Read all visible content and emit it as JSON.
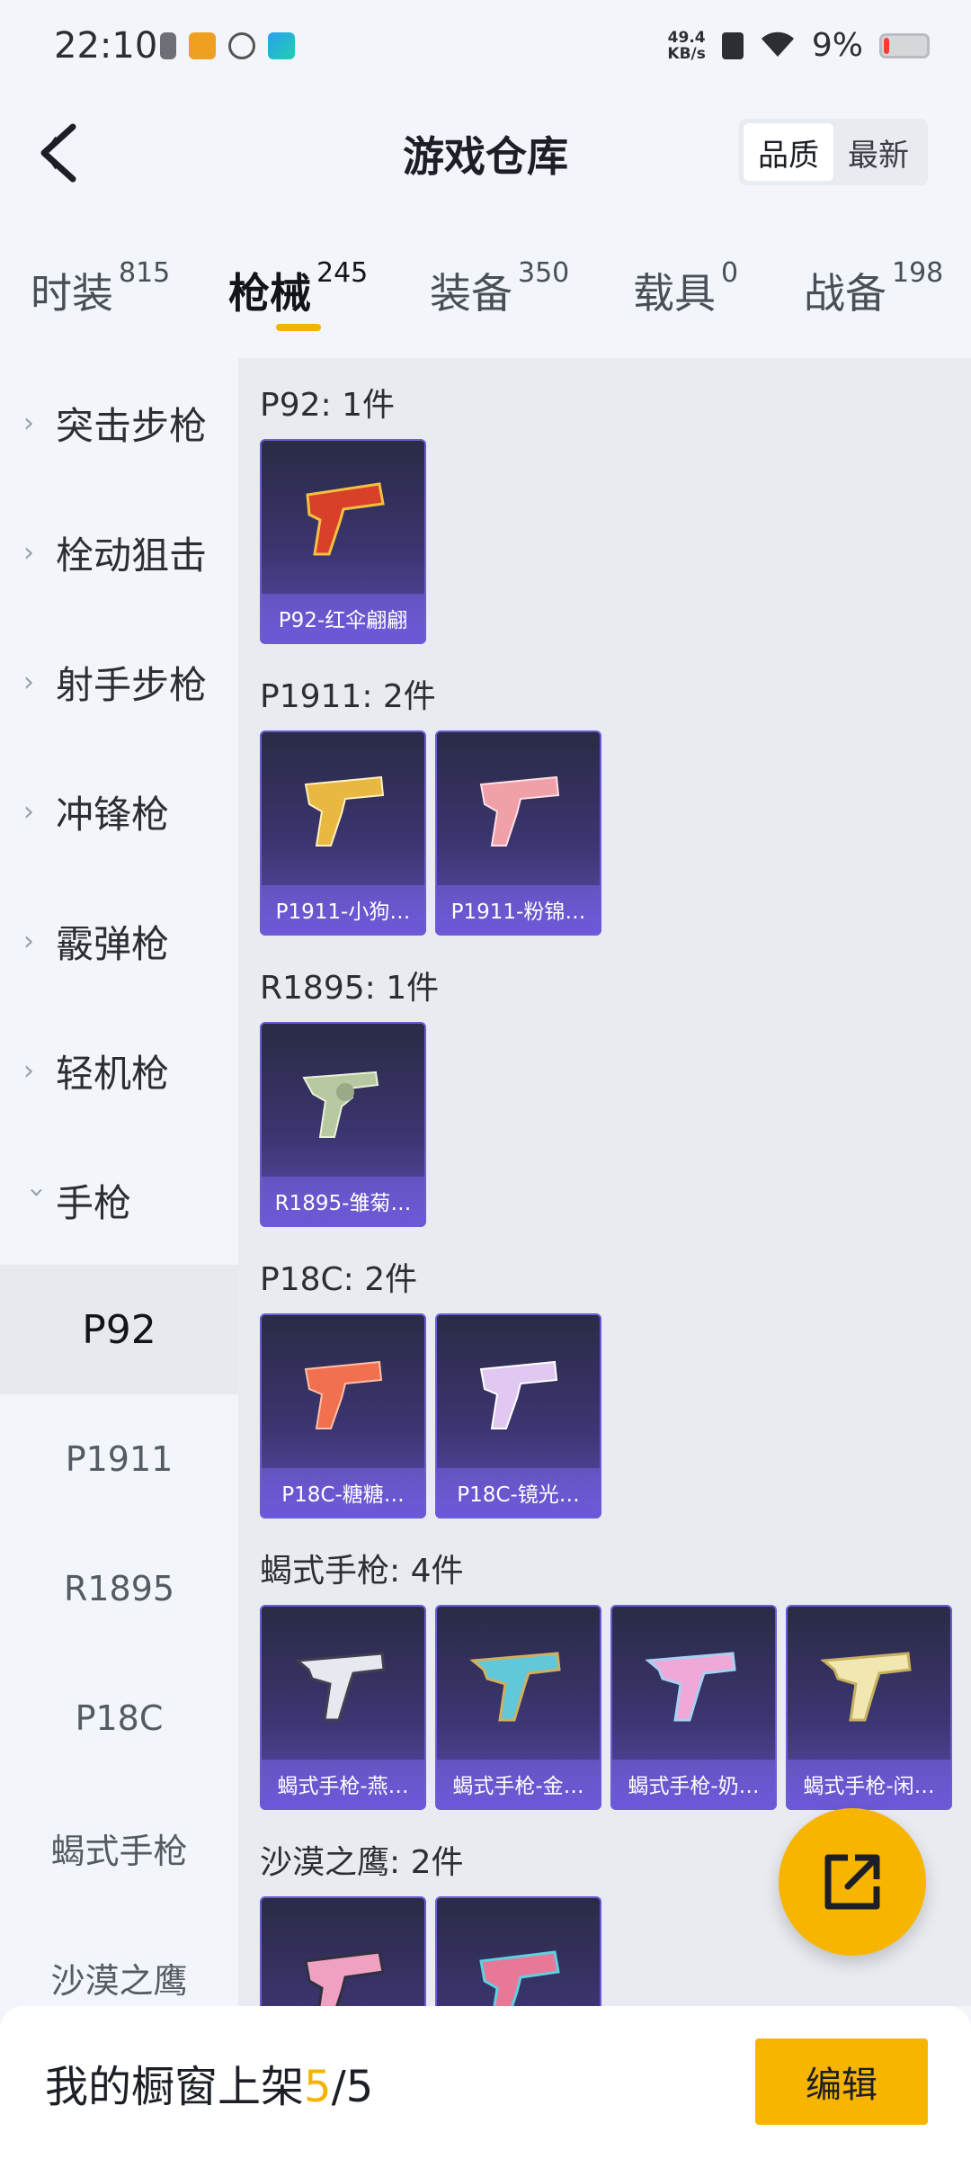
{
  "status_bar": {
    "time": "22:10",
    "net_speed_value": "49.4",
    "net_speed_unit": "KB/s",
    "battery": "9%"
  },
  "header": {
    "title": "游戏仓库",
    "sort": [
      {
        "label": "品质",
        "active": true
      },
      {
        "label": "最新",
        "active": false
      }
    ]
  },
  "tabs": [
    {
      "label": "时装",
      "count": "815"
    },
    {
      "label": "枪械",
      "count": "245"
    },
    {
      "label": "装备",
      "count": "350"
    },
    {
      "label": "载具",
      "count": "0"
    },
    {
      "label": "战备",
      "count": "198"
    }
  ],
  "active_tab": "枪械",
  "sidebar": {
    "categories": [
      "突击步枪",
      "栓动狙击",
      "射手步枪",
      "冲锋枪",
      "霰弹枪",
      "轻机枪",
      "手枪"
    ],
    "expanded": "手枪",
    "subitems": [
      "P92",
      "P1911",
      "R1895",
      "P18C",
      "蝎式手枪",
      "沙漠之鹰"
    ],
    "active_subitem": "P92"
  },
  "groups": [
    {
      "title": "P92: 1件",
      "items": [
        "P92-红伞翩翩"
      ]
    },
    {
      "title": "P1911: 2件",
      "items": [
        "P1911-小狗…",
        "P1911-粉锦…"
      ]
    },
    {
      "title": "R1895: 1件",
      "items": [
        "R1895-雏菊…"
      ]
    },
    {
      "title": "P18C: 2件",
      "items": [
        "P18C-糖糖…",
        "P18C-镜光…"
      ]
    },
    {
      "title": "蝎式手枪: 4件",
      "items": [
        "蝎式手枪-燕…",
        "蝎式手枪-金…",
        "蝎式手枪-奶…",
        "蝎式手枪-闲…"
      ]
    },
    {
      "title": "沙漠之鹰: 2件",
      "items": [
        "",
        ""
      ]
    }
  ],
  "bottom": {
    "showcase_prefix": "我的橱窗上架",
    "showcase_current": "5",
    "showcase_sep": "/",
    "showcase_total": "5",
    "edit_label": "编辑"
  },
  "colors": {
    "accent": "#f5b300",
    "card_border": "#6b5bd6"
  }
}
